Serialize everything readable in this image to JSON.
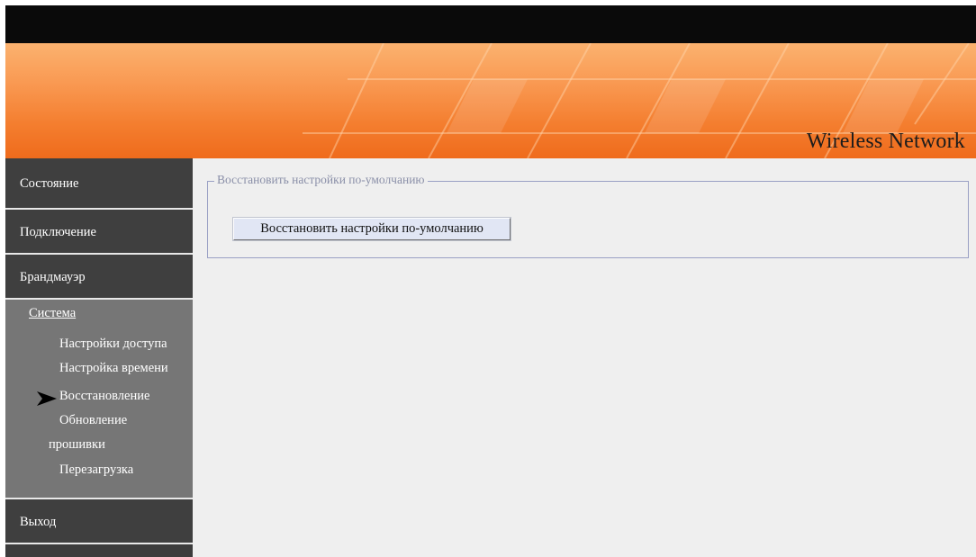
{
  "banner": {
    "title": "Wireless Network"
  },
  "sidebar": {
    "items": [
      {
        "label": "Состояние"
      },
      {
        "label": "Подключение"
      },
      {
        "label": "Брандмауэр"
      },
      {
        "label": "Система"
      },
      {
        "label": "Выход"
      }
    ],
    "system_subitems": [
      {
        "label": "Настройки доступа"
      },
      {
        "label": "Настройка времени"
      },
      {
        "label": "Восстановление",
        "active": true
      },
      {
        "label": "Обновление"
      },
      {
        "label": "прошивки"
      },
      {
        "label": "Перезагрузка"
      }
    ]
  },
  "main": {
    "fieldset_legend": "Восстановить настройки по-умолчанию",
    "restore_button_label": "Восстановить настройки по-умолчанию"
  },
  "colors": {
    "banner_orange": "#f47e2f",
    "sidebar_dark": "#3f3f3f",
    "sidebar_sub": "#767676",
    "content_bg": "#efefef",
    "fieldset_border": "#9aa0c4"
  }
}
